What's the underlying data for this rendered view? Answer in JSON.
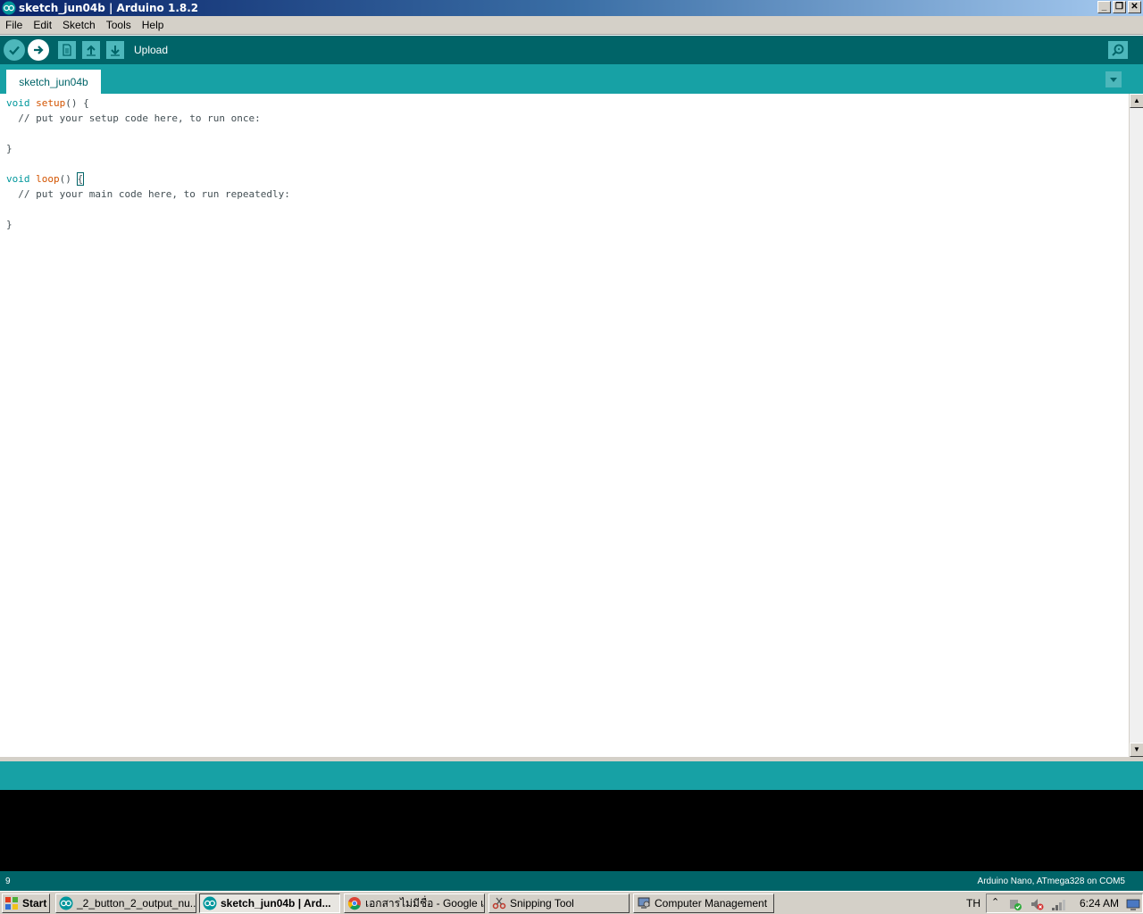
{
  "window": {
    "title": "sketch_jun04b | Arduino 1.8.2",
    "controls": [
      "minimize",
      "restore",
      "close"
    ]
  },
  "menubar": {
    "items": [
      "File",
      "Edit",
      "Sketch",
      "Tools",
      "Help"
    ]
  },
  "toolbar": {
    "status_label": "Upload",
    "buttons": [
      "verify-icon",
      "upload-icon",
      "new-icon",
      "open-icon",
      "save-icon"
    ],
    "serial_monitor": "serial-monitor-icon"
  },
  "tabs": {
    "active": "sketch_jun04b"
  },
  "editor": {
    "lines": [
      "void setup() {",
      "  // put your setup code here, to run once:",
      "",
      "}",
      "",
      "void loop() {",
      "  // put your main code here, to run repeatedly:",
      "",
      "}"
    ]
  },
  "status": {
    "line_number": "9",
    "board": "Arduino Nano, ATmega328 on COM5"
  },
  "taskbar": {
    "start": "Start",
    "tasks": [
      "_2_button_2_output_nu...",
      "sketch_jun04b | Ard...",
      "เอกสารไม่มีชื่อ - Google เ...",
      "Snipping Tool",
      "Computer Management"
    ],
    "language": "TH",
    "clock": "6:24 AM"
  },
  "colors": {
    "teal_dark": "#006468",
    "teal_light": "#17a1a5",
    "keyword": "#00979c",
    "function": "#d35400"
  }
}
